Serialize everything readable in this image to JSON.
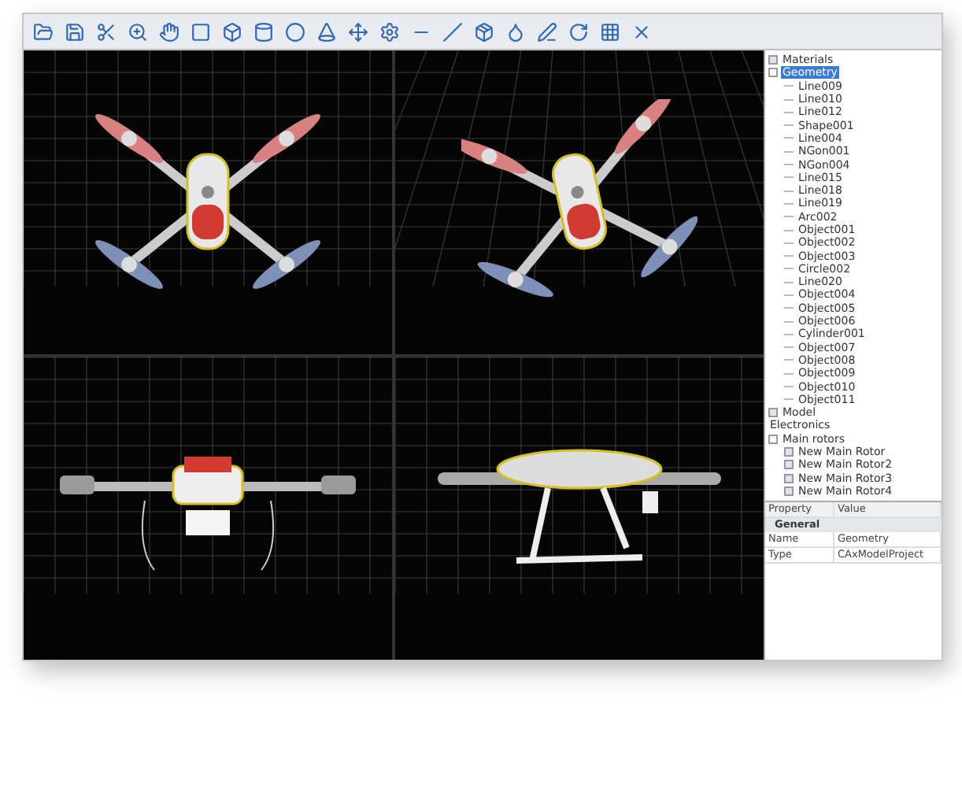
{
  "viewports": [
    {
      "kind": "top"
    },
    {
      "kind": "perspective"
    },
    {
      "kind": "front"
    },
    {
      "kind": "side"
    }
  ],
  "tree": [
    {
      "label": "Materials",
      "expanded": false,
      "selected": false
    },
    {
      "label": "Geometry",
      "expanded": true,
      "selected": true,
      "children": [
        {
          "label": "Line009"
        },
        {
          "label": "Line010"
        },
        {
          "label": "Line012"
        },
        {
          "label": "Shape001"
        },
        {
          "label": "Line004"
        },
        {
          "label": "NGon001"
        },
        {
          "label": "NGon004"
        },
        {
          "label": "Line015"
        },
        {
          "label": "Line018"
        },
        {
          "label": "Line019"
        },
        {
          "label": "Arc002"
        },
        {
          "label": "Object001"
        },
        {
          "label": "Object002"
        },
        {
          "label": "Object003"
        },
        {
          "label": "Circle002"
        },
        {
          "label": "Line020"
        },
        {
          "label": "Object004"
        },
        {
          "label": "Object005"
        },
        {
          "label": "Object006"
        },
        {
          "label": "Cylinder001"
        },
        {
          "label": "Object007"
        },
        {
          "label": "Object008"
        },
        {
          "label": "Object009"
        },
        {
          "label": "Object010"
        },
        {
          "label": "Object011"
        }
      ]
    },
    {
      "label": "Model",
      "expanded": false,
      "selected": false
    },
    {
      "label": "Electronics",
      "selected": false
    },
    {
      "label": "Main rotors",
      "expanded": true,
      "selected": false,
      "children": [
        {
          "label": "New Main Rotor",
          "expanded": false
        },
        {
          "label": "New Main Rotor2",
          "expanded": false
        },
        {
          "label": "New Main Rotor3",
          "expanded": false
        },
        {
          "label": "New Main Rotor4",
          "expanded": false
        }
      ]
    }
  ],
  "properties": {
    "columns": [
      "Property",
      "Value"
    ],
    "group": "General",
    "rows": [
      [
        "Name",
        "Geometry"
      ],
      [
        "Type",
        "CAxModelProject"
      ]
    ]
  }
}
